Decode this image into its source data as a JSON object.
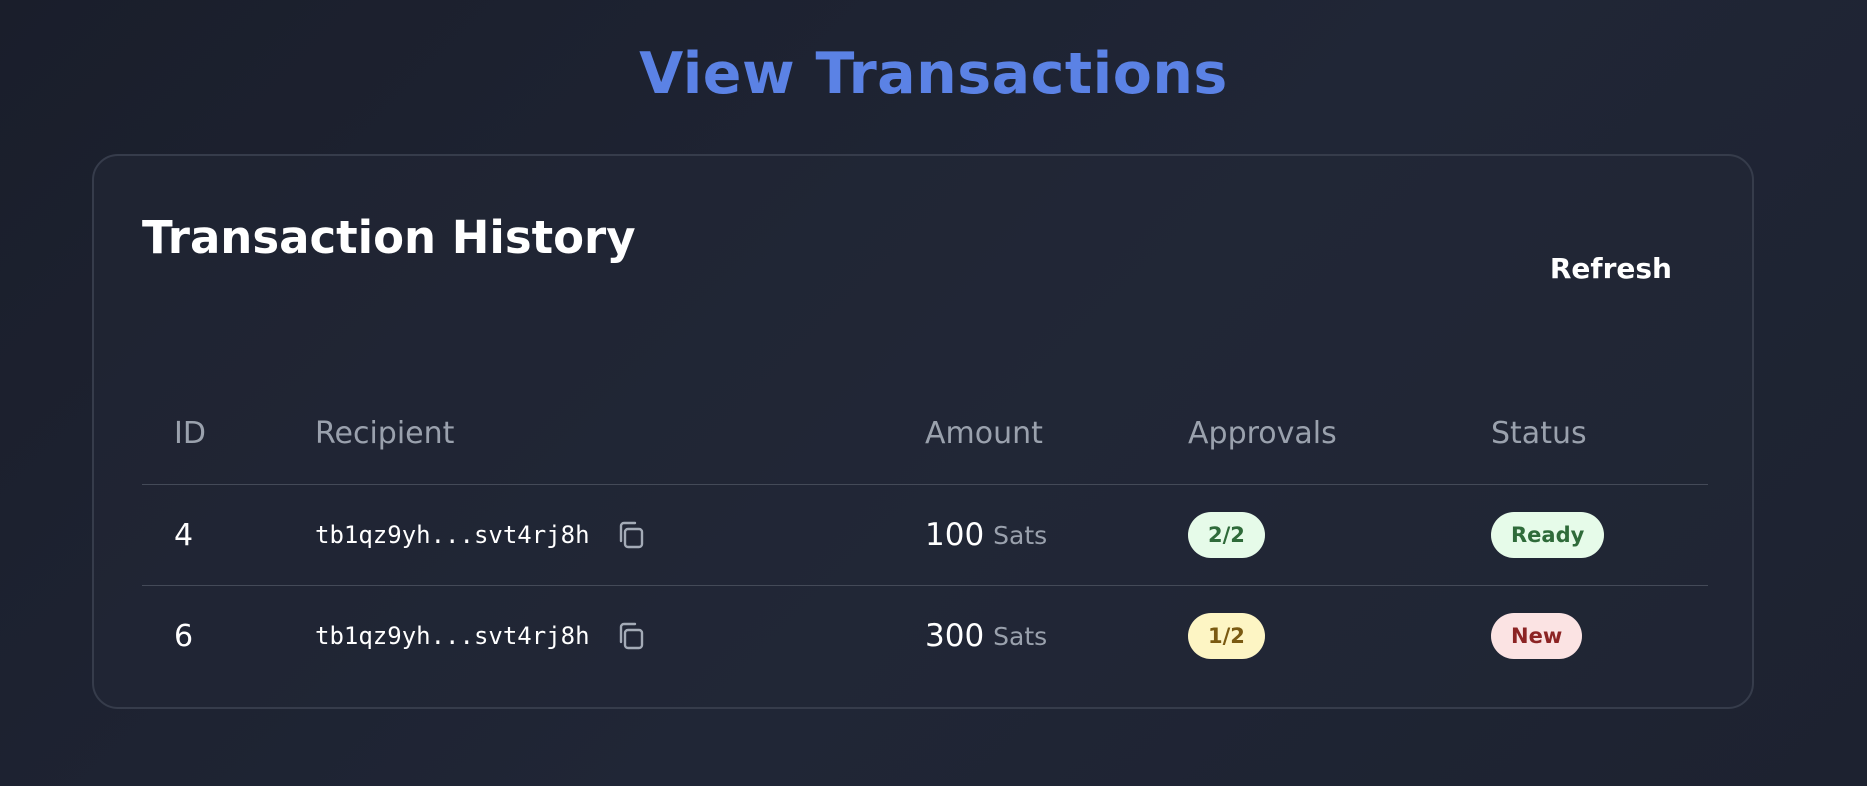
{
  "page": {
    "title": "View Transactions"
  },
  "card": {
    "title": "Transaction History",
    "refresh_label": "Refresh"
  },
  "table": {
    "columns": [
      "ID",
      "Recipient",
      "Amount",
      "Approvals",
      "Status"
    ],
    "rows": [
      {
        "id": "4",
        "recipient": "tb1qz9yh...svt4rj8h",
        "amount": "100",
        "unit": "Sats",
        "approvals": "2/2",
        "status": "Ready"
      },
      {
        "id": "6",
        "recipient": "tb1qz9yh...svt4rj8h",
        "amount": "300",
        "unit": "Sats",
        "approvals": "1/2",
        "status": "New"
      }
    ]
  },
  "icons": {
    "copy": "copy-icon"
  },
  "colors": {
    "title_accent": "#5b82e5",
    "approval_complete_bg": "#e6fbe9",
    "approval_complete_text": "#2f6b3a",
    "approval_partial_bg": "#fdf5c4",
    "approval_partial_text": "#7a5a12",
    "status_ready_bg": "#e6fbe9",
    "status_ready_text": "#2f6b3a",
    "status_new_bg": "#fbe3e3",
    "status_new_text": "#8c2424"
  }
}
